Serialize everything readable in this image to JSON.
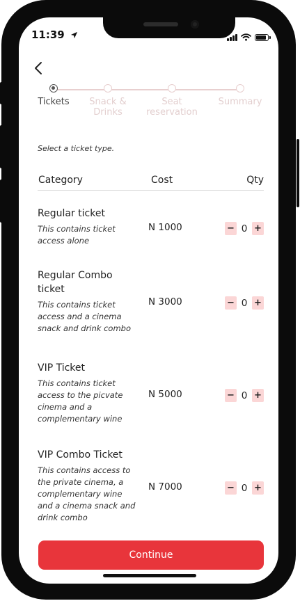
{
  "status_bar": {
    "time": "11:39"
  },
  "stepper": {
    "steps": [
      {
        "label_line1": "Tickets",
        "label_line2": ""
      },
      {
        "label_line1": "Snack &",
        "label_line2": "Drinks"
      },
      {
        "label_line1": "Seat",
        "label_line2": "reservation"
      },
      {
        "label_line1": "Summary",
        "label_line2": ""
      }
    ],
    "active_index": 0
  },
  "hint": "Select a ticket type.",
  "table": {
    "headers": {
      "category": "Category",
      "cost": "Cost",
      "qty": "Qty"
    },
    "rows": [
      {
        "title_lines": [
          "Regular ticket"
        ],
        "desc_lines": [
          "This contains ticket",
          "access alone"
        ],
        "cost": "N 1000",
        "qty": "0"
      },
      {
        "title_lines": [
          "Regular Combo",
          "ticket"
        ],
        "desc_lines": [
          "This contains ticket",
          "access and a cinema",
          "snack and drink combo"
        ],
        "cost": "N 3000",
        "qty": "0"
      },
      {
        "title_lines": [
          "VIP Ticket"
        ],
        "desc_lines": [
          "This contains ticket",
          "access to the picvate",
          "cinema and a",
          "complementary wine"
        ],
        "cost": "N 5000",
        "qty": "0"
      },
      {
        "title_lines": [
          "VIP Combo Ticket"
        ],
        "desc_lines": [
          "This contains access to",
          "the private cinema, a",
          "complementary wine",
          "and a cinema snack and",
          "drink combo"
        ],
        "cost": "N 7000",
        "qty": "0"
      }
    ],
    "minus_label": "−",
    "plus_label": "+"
  },
  "continue_label": "Continue",
  "colors": {
    "accent": "#e8353b",
    "qty_button_bg": "#fbd6d6",
    "inactive_step": "#e3cfcf"
  }
}
